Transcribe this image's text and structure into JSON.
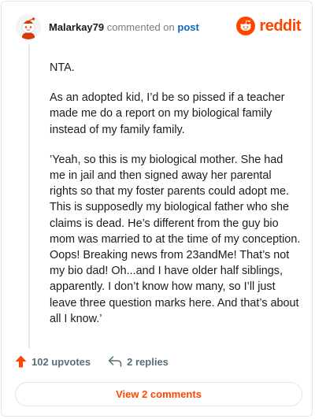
{
  "header": {
    "username": "Malarkay79",
    "commented_text": "commented on",
    "post_link": "post",
    "brand": "reddit"
  },
  "comment": {
    "paragraphs": [
      "NTA.",
      "As an adopted kid, I’d be so pissed if a teacher made me do a report on my biological family instead of my family family.",
      "’Yeah, so this is my biological mother. She had me in jail and then signed away her parental rights so that my foster parents could adopt me. This is supposedly my biological father who she claims is dead. He’s different from the guy bio mom was married to at the time of my conception. Oops! Breaking news from 23andMe! That’s not my bio dad! Oh...and I have older half siblings, apparently. I don’t know how many, so I’ll just leave three question marks here. And that’s about all I know.’"
    ]
  },
  "actions": {
    "upvotes": "102 upvotes",
    "replies": "2 replies"
  },
  "view_comments": "View 2 comments",
  "colors": {
    "accent": "#ff4500",
    "link": "#0a66c2"
  }
}
